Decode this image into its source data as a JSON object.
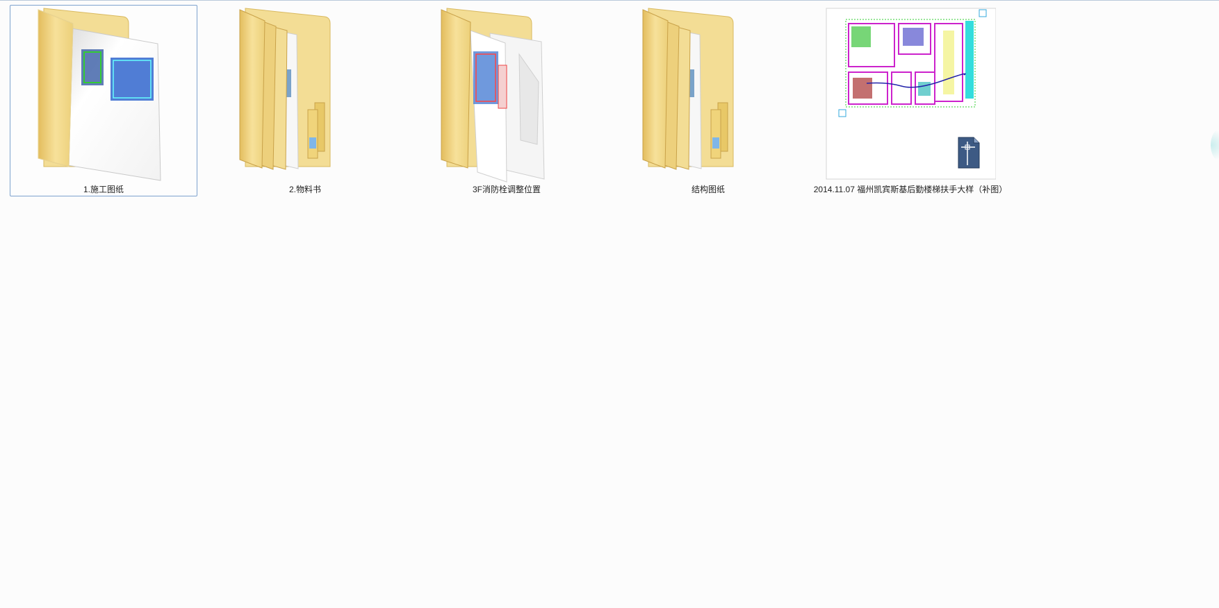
{
  "items": [
    {
      "name": "1.施工图纸",
      "kind": "folder",
      "selected": true
    },
    {
      "name": "2.物料书",
      "kind": "folder",
      "selected": false
    },
    {
      "name": "3F消防栓调整位置",
      "kind": "folder",
      "selected": false
    },
    {
      "name": "结构图纸",
      "kind": "folder",
      "selected": false
    },
    {
      "name": "2014.11.07 福州凯宾斯基后勤楼梯扶手大样（补图）",
      "kind": "dwg-file",
      "selected": false
    }
  ],
  "icons": {
    "folder": "folder-icon",
    "dwg_file": "autocad-dwg-file-icon"
  },
  "colors": {
    "selection_border": "#7da2ce",
    "folder_yellow": "#f2d77e",
    "background": "#fcfcfc"
  }
}
